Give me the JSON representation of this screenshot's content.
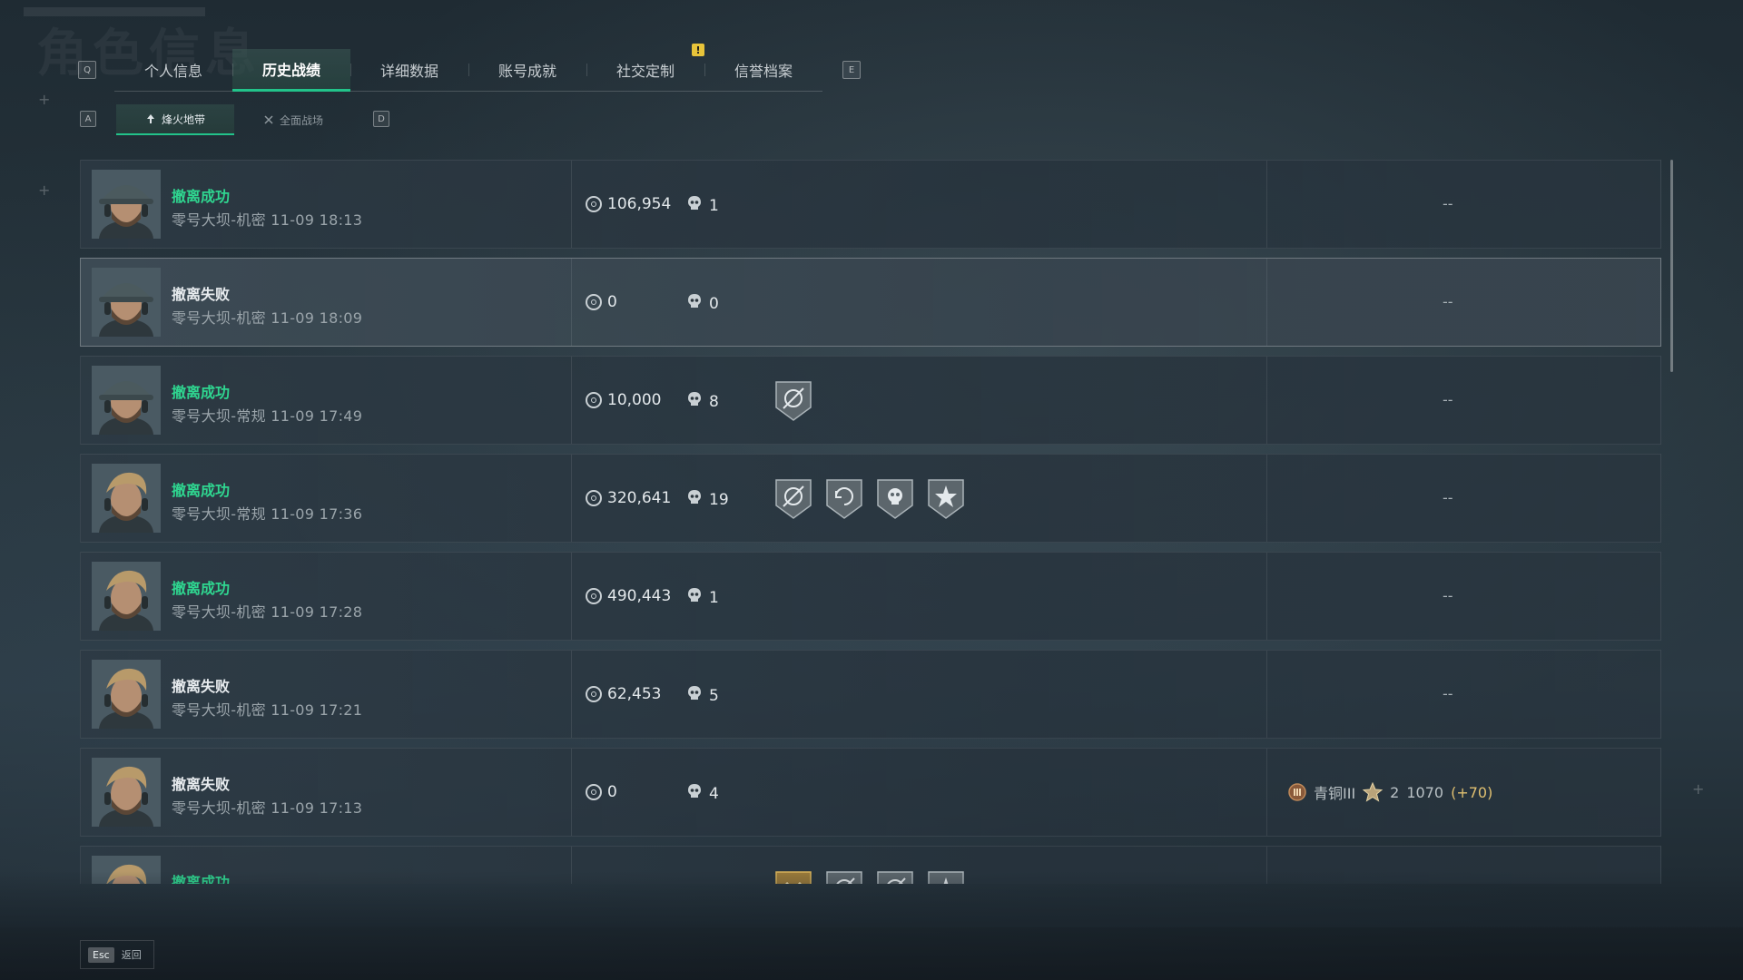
{
  "background_title": "角色信息",
  "key_hints": {
    "prev_tab": "Q",
    "next_tab": "E",
    "prev_sub": "A",
    "next_sub": "D"
  },
  "tabs": [
    {
      "label": "个人信息",
      "active": false
    },
    {
      "label": "历史战绩",
      "active": true
    },
    {
      "label": "详细数据",
      "active": false
    },
    {
      "label": "账号成就",
      "active": false
    },
    {
      "label": "社交定制",
      "active": false
    },
    {
      "label": "信誉档案",
      "active": false
    }
  ],
  "tab_badge": "!",
  "subtabs": [
    {
      "label": "烽火地带",
      "icon": "extraction-mode-icon",
      "active": true
    },
    {
      "label": "全面战场",
      "icon": "warfare-mode-icon",
      "active": false
    }
  ],
  "records": [
    {
      "status": "撤离成功",
      "success": true,
      "meta": "零号大坝-机密 11-09 18:13",
      "value": "106,954",
      "kills": "1",
      "badges": [],
      "right": "--",
      "operator": "cap"
    },
    {
      "status": "撤离失败",
      "success": false,
      "meta": "零号大坝-机密 11-09 18:09",
      "value": "0",
      "kills": "0",
      "badges": [],
      "right": "--",
      "operator": "cap",
      "selected": true
    },
    {
      "status": "撤离成功",
      "success": true,
      "meta": "零号大坝-常规 11-09 17:49",
      "value": "10,000",
      "kills": "8",
      "badges": [
        "crosshair-badge"
      ],
      "right": "--",
      "operator": "cap"
    },
    {
      "status": "撤离成功",
      "success": true,
      "meta": "零号大坝-常规 11-09 17:36",
      "value": "320,641",
      "kills": "19",
      "badges": [
        "crosshair-badge",
        "reload-badge",
        "skull-badge",
        "burst-badge"
      ],
      "right": "--",
      "operator": "blond"
    },
    {
      "status": "撤离成功",
      "success": true,
      "meta": "零号大坝-机密 11-09 17:28",
      "value": "490,443",
      "kills": "1",
      "badges": [],
      "right": "--",
      "operator": "blond"
    },
    {
      "status": "撤离失败",
      "success": false,
      "meta": "零号大坝-机密 11-09 17:21",
      "value": "62,453",
      "kills": "5",
      "badges": [],
      "right": "--",
      "operator": "blond"
    },
    {
      "status": "撤离失败",
      "success": false,
      "meta": "零号大坝-机密 11-09 17:13",
      "value": "0",
      "kills": "4",
      "badges": [],
      "right": "",
      "operator": "blond",
      "rank": {
        "name": "青铜III",
        "stars": "2",
        "score": "1070",
        "delta": "(+70)"
      }
    },
    {
      "status": "撤离成功",
      "success": true,
      "meta": "",
      "value": "",
      "kills": "",
      "badges": [
        "gold-badge",
        "crosshair-badge",
        "crosshair-badge",
        "burst-badge"
      ],
      "right": "",
      "operator": "blond"
    }
  ],
  "footer": {
    "esc_key": "Esc",
    "esc_label": "返回"
  },
  "colors": {
    "accent": "#22c38a",
    "success": "#2fd690",
    "badge_yellow": "#e8c43a"
  }
}
